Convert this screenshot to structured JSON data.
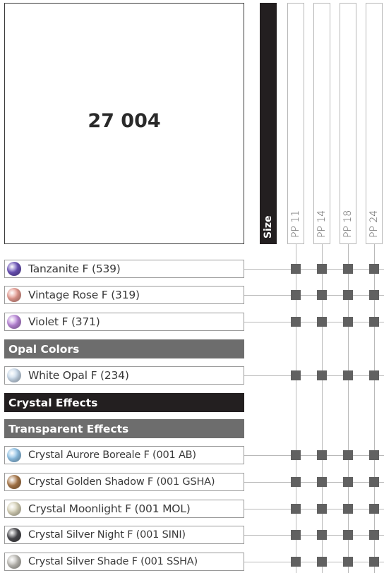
{
  "product": {
    "code": "27 004"
  },
  "columns": {
    "size_label": "Size",
    "sizes": [
      "PP 11",
      "PP 14",
      "PP 18",
      "PP 24"
    ]
  },
  "rows": [
    {
      "type": "item",
      "label": "Tanzanite F (539)",
      "color": "#6b52b8",
      "available": [
        true,
        true,
        true,
        true
      ]
    },
    {
      "type": "item",
      "label": "Vintage Rose F (319)",
      "color": "#e49a90",
      "available": [
        true,
        true,
        true,
        true
      ]
    },
    {
      "type": "item",
      "label": "Violet F (371)",
      "color": "#b986d8",
      "available": [
        true,
        true,
        true,
        true
      ]
    },
    {
      "type": "category",
      "label": "Opal Colors",
      "style": "grey"
    },
    {
      "type": "item",
      "label": "White Opal F (234)",
      "color": "#c9d9ea",
      "available": [
        true,
        true,
        true,
        true
      ]
    },
    {
      "type": "category",
      "label": "Crystal Effects",
      "style": "black"
    },
    {
      "type": "category",
      "label": "Transparent Effects",
      "style": "grey"
    },
    {
      "type": "item",
      "label": "Crystal Aurore Boreale F (001 AB)",
      "color": "#8fc2e6",
      "available": [
        true,
        true,
        true,
        true
      ]
    },
    {
      "type": "item",
      "label": "Crystal Golden Shadow F (001 GSHA)",
      "color": "#a9784a",
      "available": [
        true,
        true,
        true,
        true
      ]
    },
    {
      "type": "item",
      "label": "Crystal Moonlight F (001 MOL)",
      "color": "#d7d2b8",
      "available": [
        true,
        true,
        true,
        true
      ]
    },
    {
      "type": "item",
      "label": "Crystal Silver Night F (001 SINI)",
      "color": "#4a4a4e",
      "available": [
        true,
        true,
        true,
        true
      ]
    },
    {
      "type": "item",
      "label": "Crystal Silver Shade F (001 SSHA)",
      "color": "#bcbab4",
      "available": [
        true,
        true,
        true,
        true
      ]
    }
  ]
}
